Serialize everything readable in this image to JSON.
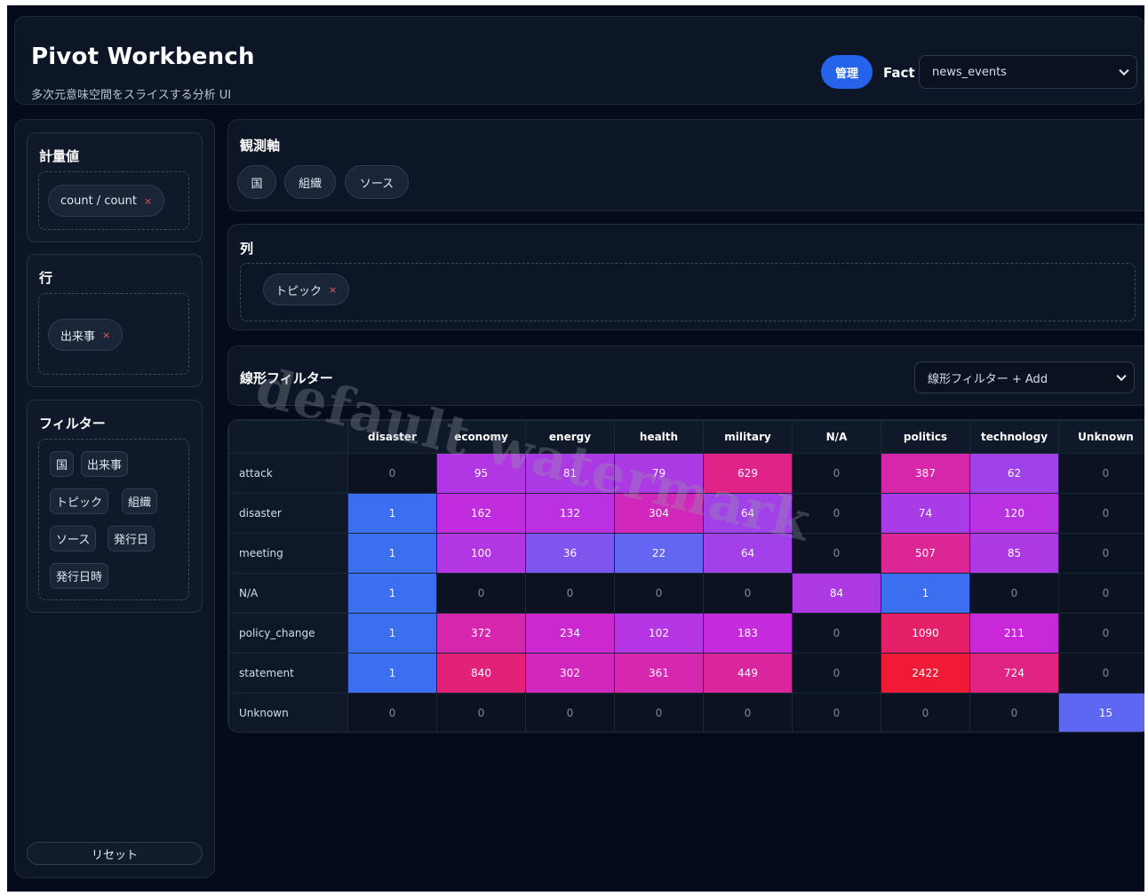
{
  "header": {
    "title": "Pivot Workbench",
    "subtitle": "多次元意味空間をスライスする分析 UI",
    "admin_label": "管理",
    "fact_label": "Fact",
    "fact_value": "news_events"
  },
  "sidebar": {
    "measures_title": "計量値",
    "measure_chip": "count / count",
    "rows_title": "行",
    "row_chip": "出来事",
    "filters_title": "フィルター",
    "filter_fields": [
      "国",
      "出来事",
      "トピック",
      "組織",
      "ソース",
      "発行日",
      "発行日時"
    ],
    "reset_label": "リセット"
  },
  "observation": {
    "title": "観測軸",
    "axes": [
      "国",
      "組織",
      "ソース"
    ]
  },
  "columns": {
    "title": "列",
    "chip": "トピック"
  },
  "linear_filter": {
    "title": "線形フィルター",
    "select_value": "線形フィルター + Add"
  },
  "remove_icon": "×",
  "watermark": "default watermark",
  "colors": {
    "accent": "#2563eb",
    "heat_low": "#3b6ff0",
    "heat_mid": "#c026d3",
    "heat_high": "#f01a37"
  },
  "pivot": {
    "columns": [
      "disaster",
      "economy",
      "energy",
      "health",
      "military",
      "N/A",
      "politics",
      "technology",
      "Unknown"
    ],
    "rows": [
      {
        "label": "attack",
        "values": [
          0,
          95,
          81,
          79,
          629,
          0,
          387,
          62,
          0
        ]
      },
      {
        "label": "disaster",
        "values": [
          1,
          162,
          132,
          304,
          64,
          0,
          74,
          120,
          0
        ]
      },
      {
        "label": "meeting",
        "values": [
          1,
          100,
          36,
          22,
          64,
          0,
          507,
          85,
          0
        ]
      },
      {
        "label": "N/A",
        "values": [
          1,
          0,
          0,
          0,
          0,
          84,
          1,
          0,
          0
        ]
      },
      {
        "label": "policy_change",
        "values": [
          1,
          372,
          234,
          102,
          183,
          0,
          1090,
          211,
          0
        ]
      },
      {
        "label": "statement",
        "values": [
          1,
          840,
          302,
          361,
          449,
          0,
          2422,
          724,
          0
        ]
      },
      {
        "label": "Unknown",
        "values": [
          0,
          0,
          0,
          0,
          0,
          0,
          0,
          0,
          15
        ]
      }
    ]
  }
}
